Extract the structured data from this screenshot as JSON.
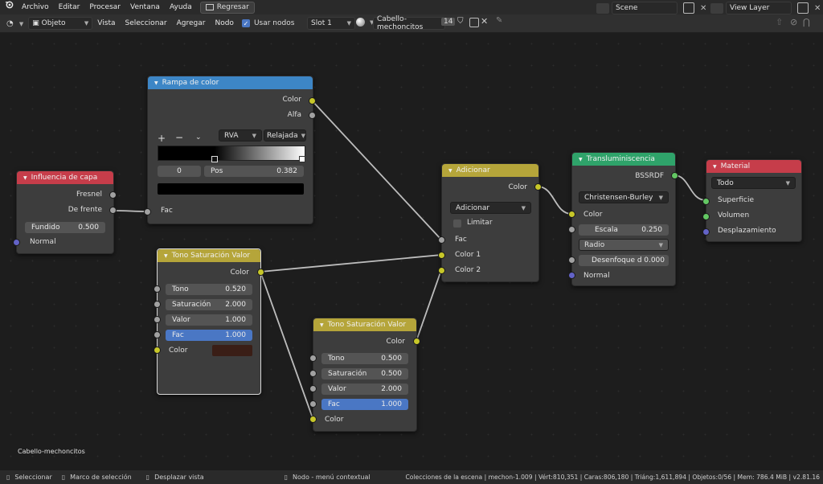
{
  "menu": {
    "items": [
      "Archivo",
      "Editar",
      "Procesar",
      "Ventana",
      "Ayuda"
    ],
    "back_label": "Regresar",
    "scene": "Scene",
    "view_layer": "View Layer"
  },
  "header": {
    "mode": "Objeto",
    "vista": "Vista",
    "seleccionar": "Seleccionar",
    "agregar": "Agregar",
    "nodo": "Nodo",
    "use_nodes": "Usar nodos",
    "slot": "Slot 1",
    "material": "Cabello-mechoncitos",
    "users": "14"
  },
  "canvas_label": "Cabello-mechoncitos",
  "nodes": {
    "ramp": {
      "title": "Rampa de color",
      "out_color": "Color",
      "out_alpha": "Alfa",
      "mode": "RVA",
      "interp": "Relajada",
      "index": "0",
      "pos_label": "Pos",
      "pos_value": "0.382",
      "in_fac": "Fac"
    },
    "layer": {
      "title": "Influencia de capa",
      "fresnel": "Fresnel",
      "facing": "De frente",
      "blend_label": "Fundido",
      "blend_value": "0.500",
      "normal": "Normal"
    },
    "hsv1": {
      "title": "Tono Saturación Valor",
      "out": "Color",
      "hue_l": "Tono",
      "hue_v": "0.520",
      "sat_l": "Saturación",
      "sat_v": "2.000",
      "val_l": "Valor",
      "val_v": "1.000",
      "fac_l": "Fac",
      "fac_v": "1.000",
      "color_l": "Color",
      "color_swatch": "#3a1e16"
    },
    "hsv2": {
      "title": "Tono Saturación Valor",
      "out": "Color",
      "hue_l": "Tono",
      "hue_v": "0.500",
      "sat_l": "Saturación",
      "sat_v": "0.500",
      "val_l": "Valor",
      "val_v": "2.000",
      "fac_l": "Fac",
      "fac_v": "1.000",
      "color_l": "Color"
    },
    "add": {
      "title": "Adicionar",
      "out": "Color",
      "op": "Adicionar",
      "clamp": "Limitar",
      "fac": "Fac",
      "c1": "Color 1",
      "c2": "Color 2"
    },
    "sss": {
      "title": "Transluminiscencia",
      "out": "BSSRDF",
      "method": "Christensen-Burley",
      "color": "Color",
      "scale_l": "Escala",
      "scale_v": "0.250",
      "radius": "Radio",
      "blur_l": "Desenfoque d",
      "blur_v": "0.000",
      "normal": "Normal"
    },
    "output": {
      "title": "Material",
      "target": "Todo",
      "surface": "Superficie",
      "volume": "Volumen",
      "displacement": "Desplazamiento"
    }
  },
  "status": {
    "select": "Seleccionar",
    "box": "Marco de selección",
    "pan": "Desplazar vista",
    "context": "Nodo - menú contextual",
    "stats": "Colecciones de la escena | mechon-1.009 | Vért:810,351 | Caras:806,180 | Triáng:1,611,894 | Objetos:0/56 | Mem: 786.4 MiB | v2.81.16"
  },
  "colors": {
    "ramp_header": "#3d86c6",
    "layer_header": "#c63d4a",
    "hsv_header": "#b5a53a",
    "add_header": "#b5a53a",
    "sss_header": "#2fa36a",
    "material_header": "#c63d4a",
    "blue_field": "#4a77c4"
  }
}
